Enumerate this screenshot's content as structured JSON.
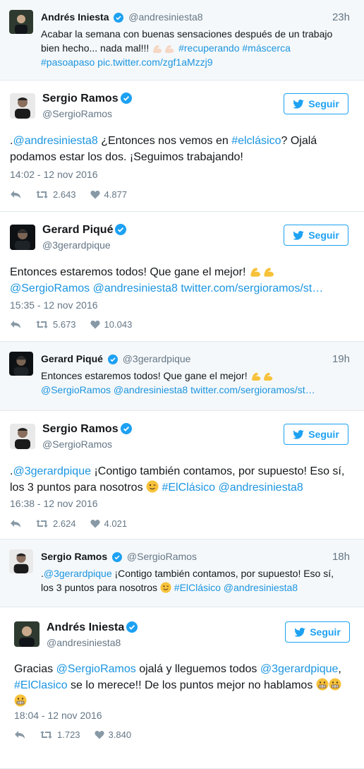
{
  "tweet1": {
    "name": "Andrés Iniesta",
    "handle": "@andresiniesta8",
    "time": "23h",
    "line1": "Acabar la semana con buenas sensaciones después de un trabajo",
    "line2a": "bien hecho... nada mal!!!",
    "line2b": "#recuperando #máscerca",
    "line3": "#pasoapaso pic.twitter.com/zgf1aMzzj9"
  },
  "tweet2": {
    "name": "Sergio Ramos",
    "handle": "@SergioRamos",
    "follow_label": "Seguir",
    "text_pre": ".",
    "mention": "@andresiniesta8",
    "text_mid": " ¿Entonces nos vemos en ",
    "hashtag": "#elclásico",
    "text_post": "? Ojalá",
    "line2": "podamos estar los dos. ¡Seguimos trabajando!",
    "date": "14:02 - 12 nov 2016",
    "retweets": "2.643",
    "likes": "4.877"
  },
  "tweet3": {
    "name": "Gerard Piqué",
    "handle": "@3gerardpique",
    "follow_label": "Seguir",
    "line1": "Entonces estaremos todos! Que gane el mejor!",
    "line2": "@SergioRamos @andresiniesta8 twitter.com/sergioramos/st…",
    "date": "15:35 - 12 nov 2016",
    "retweets": "5.673",
    "likes": "10.043"
  },
  "tweet4": {
    "name": "Gerard Piqué",
    "handle": "@3gerardpique",
    "time": "19h",
    "line1": "Entonces estaremos todos! Que gane el mejor!",
    "line2": "@SergioRamos @andresiniesta8 twitter.com/sergioramos/st…"
  },
  "tweet5": {
    "name": "Sergio Ramos",
    "handle": "@SergioRamos",
    "follow_label": "Seguir",
    "text_pre": ".",
    "mention": "@3gerardpique",
    "text_mid": " ¡Contigo también contamos, por supuesto! Eso sí,",
    "line2a": "los 3 puntos para nosotros",
    "line2b": "#ElClásico @andresiniesta8",
    "date": "16:38 - 12 nov 2016",
    "retweets": "2.624",
    "likes": "4.021"
  },
  "tweet6": {
    "name": "Sergio Ramos",
    "handle": "@SergioRamos",
    "time": "18h",
    "text_pre": ".",
    "mention": "@3gerardpique",
    "text_mid": " ¡Contigo también contamos, por supuesto! Eso sí,",
    "line2a": "los 3 puntos para nosotros",
    "line2b": "#ElClásico @andresiniesta8"
  },
  "tweet7": {
    "name": "Andrés Iniesta",
    "handle": "@andresiniesta8",
    "follow_label": "Seguir",
    "t1": "Gracias ",
    "m1": "@SergioRamos",
    "t2": " ojalá y lleguemos todos ",
    "m2": "@3gerardpique",
    "t3": ",",
    "h1": "#ElClasico",
    "t4": " se lo merece!! De los puntos mejor no hablamos",
    "date": "18:04 - 12 nov 2016",
    "retweets": "1.723",
    "likes": "3.840"
  },
  "colors": {
    "link": "#1b95e0",
    "muted": "#657786",
    "accent": "#1da1f2",
    "compact_bg": "#f5f8fa"
  },
  "icons": [
    "verified-icon",
    "twitter-bird-icon",
    "reply-icon",
    "retweet-icon",
    "heart-icon",
    "flexed-biceps-icon",
    "wink-face-icon",
    "grimace-face-icon"
  ]
}
